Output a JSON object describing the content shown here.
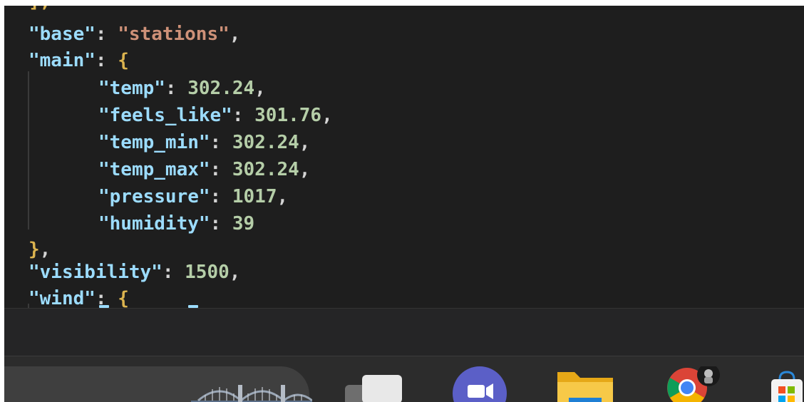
{
  "editor": {
    "lines": {
      "partial_top": "],",
      "base_key": "\"base\"",
      "base_value": "\"stations\"",
      "main_key": "\"main\"",
      "open_brace": "{",
      "temp_key": "\"temp\"",
      "temp_value": "302.24",
      "feels_like_key": "\"feels_like\"",
      "feels_like_value": "301.76",
      "temp_min_key": "\"temp_min\"",
      "temp_min_value": "302.24",
      "temp_max_key": "\"temp_max\"",
      "temp_max_value": "302.24",
      "pressure_key": "\"pressure\"",
      "pressure_value": "1017",
      "humidity_key": "\"humidity\"",
      "humidity_value": "39",
      "close_brace": "}",
      "visibility_key": "\"visibility\"",
      "visibility_value": "1500",
      "wind_key": "\"wind\"",
      "wind_open_brace": "{"
    },
    "colors": {
      "background": "#1e1e1e",
      "key": "#9cdcfe",
      "string": "#ce9178",
      "number": "#b5cea8",
      "brace": "#dcb44f"
    }
  },
  "taskbar": {
    "icons": [
      "widgets-bridge-icon",
      "task-view-icon",
      "teams-icon",
      "file-explorer-icon",
      "chrome-icon",
      "microsoft-store-icon"
    ]
  }
}
